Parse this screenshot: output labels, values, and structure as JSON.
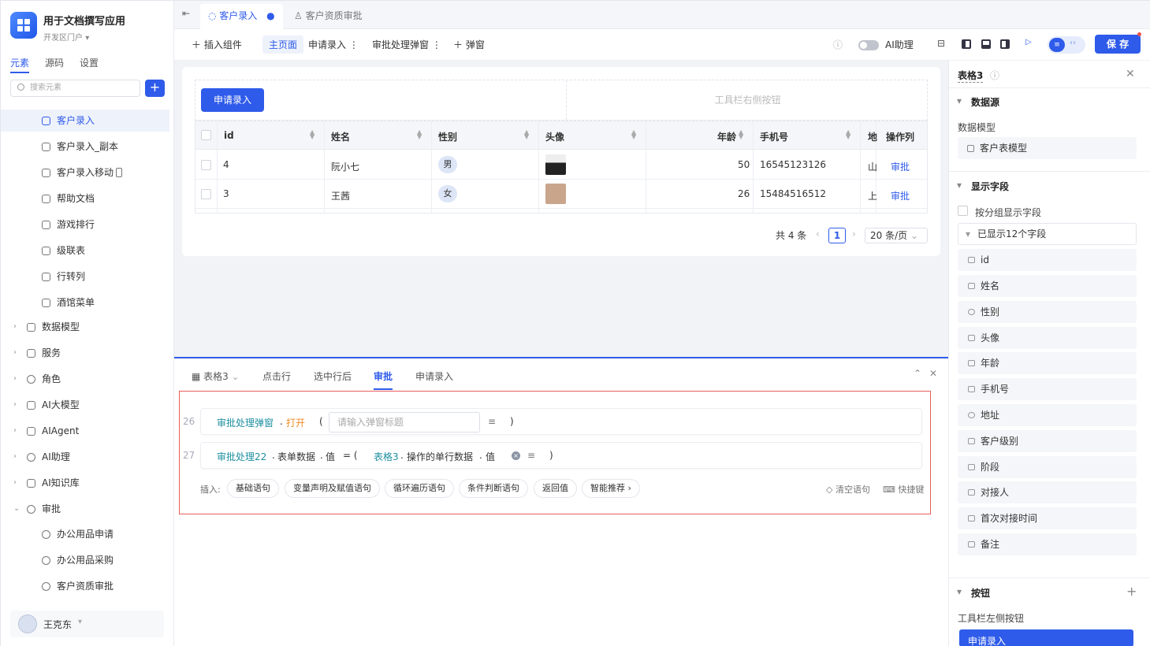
{
  "app": {
    "title": "用于文档撰写应用",
    "subtitle": "开发区门户"
  },
  "left_tabs": [
    "元素",
    "源码",
    "设置"
  ],
  "search": {
    "placeholder": "搜索元素"
  },
  "tree": [
    {
      "label": "客户录入",
      "selected": true,
      "indent": 2
    },
    {
      "label": "客户录入_副本",
      "indent": 2
    },
    {
      "label": "客户录入移动",
      "indent": 2
    },
    {
      "label": "帮助文档",
      "indent": 2
    },
    {
      "label": "游戏排行",
      "indent": 2
    },
    {
      "label": "级联表",
      "indent": 2
    },
    {
      "label": "行转列",
      "indent": 2
    },
    {
      "label": "酒馆菜单",
      "indent": 2
    },
    {
      "label": "数据模型",
      "indent": 1,
      "arrow": "›"
    },
    {
      "label": "服务",
      "indent": 1,
      "arrow": "›"
    },
    {
      "label": "角色",
      "indent": 1,
      "arrow": "›"
    },
    {
      "label": "AI大模型",
      "indent": 1,
      "arrow": "›"
    },
    {
      "label": "AIAgent",
      "indent": 1,
      "arrow": "›"
    },
    {
      "label": "AI助理",
      "indent": 1,
      "arrow": "›"
    },
    {
      "label": "AI知识库",
      "indent": 1,
      "arrow": "›"
    },
    {
      "label": "审批",
      "indent": 1,
      "arrow": "⌄"
    },
    {
      "label": "办公用品申请",
      "indent": 2
    },
    {
      "label": "办公用品采购",
      "indent": 2
    },
    {
      "label": "客户资质审批",
      "indent": 2
    }
  ],
  "user": {
    "name": "王克东"
  },
  "top_tabs": [
    {
      "label": "客户录入",
      "active": true
    },
    {
      "label": "客户资质审批",
      "active": false
    }
  ],
  "toolbar": {
    "insert": "插入组件",
    "main_page": "主页面",
    "apply": "申请录入",
    "approve_popup": "审批处理弹窗",
    "popup": "弹窗",
    "ai_assistant": "AI助理",
    "save": "保 存"
  },
  "canvas": {
    "apply_button": "申请录入",
    "right_placeholder": "工具栏右侧按钮",
    "columns": [
      "id",
      "姓名",
      "性别",
      "头像",
      "年龄",
      "手机号",
      "地",
      "操作列"
    ],
    "rows": [
      {
        "id": "4",
        "name": "阮小七",
        "gender": "男",
        "age": "50",
        "phone": "16545123126",
        "addr": "山",
        "action": "审批"
      },
      {
        "id": "3",
        "name": "王茜",
        "gender": "女",
        "age": "26",
        "phone": "15484516512",
        "addr": "上",
        "action": "审批"
      }
    ],
    "pager": {
      "total": "共 4 条",
      "page": "1",
      "size": "20 条/页"
    }
  },
  "bottom": {
    "tabs": [
      "表格3",
      "点击行",
      "选中行后",
      "审批",
      "申请录入"
    ],
    "active_tab": "审批",
    "lines": [
      {
        "num": "26",
        "obj": "审批处理弹窗",
        "dot": ".",
        "method": "打开",
        "paren_open": "(",
        "placeholder": "请输入弹窗标题",
        "paren_close": ")"
      },
      {
        "num": "27",
        "obj": "审批处理22",
        "p1": ".",
        "f1": "表单数据",
        "p2": ".",
        "f2": "值",
        "eq": "= (",
        "obj2": "表格3",
        "p3": ".",
        "f3": "操作的单行数据",
        "p4": ".",
        "f4": "值",
        "paren_close": ")"
      }
    ],
    "insert_label": "插入:",
    "insert_buttons": [
      "基础语句",
      "变量声明及赋值语句",
      "循环遍历语句",
      "条件判断语句",
      "返回值",
      "智能推荐 ›"
    ],
    "clear": "清空语句",
    "shortcut": "快捷键"
  },
  "right": {
    "title": "表格3",
    "datasource": "数据源",
    "model_label": "数据模型",
    "model_value": "客户表模型",
    "display_fields": "显示字段",
    "group_display": "按分组显示字段",
    "shown_fields": "已显示12个字段",
    "fields": [
      "id",
      "姓名",
      "性别",
      "头像",
      "年龄",
      "手机号",
      "地址",
      "客户级别",
      "阶段",
      "对接人",
      "首次对接时间",
      "备注"
    ],
    "buttons_section": "按钮",
    "toolbar_left": "工具栏左侧按钮",
    "apply_btn": "申请录入"
  }
}
